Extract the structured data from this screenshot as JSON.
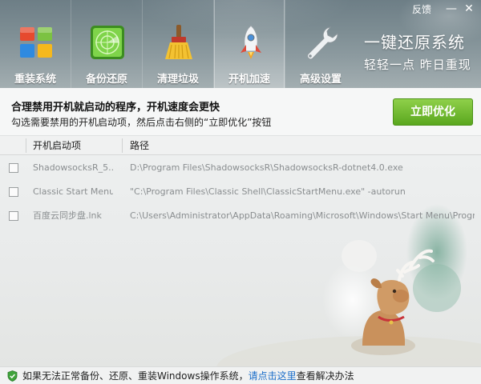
{
  "window": {
    "feedback_label": "反馈",
    "minimize_label": "—",
    "close_label": "✕"
  },
  "tabs": [
    {
      "label": "重装系统",
      "icon": "windows-logo-icon",
      "active": false
    },
    {
      "label": "备份还原",
      "icon": "radar-icon",
      "active": false
    },
    {
      "label": "清理垃圾",
      "icon": "broom-icon",
      "active": false
    },
    {
      "label": "开机加速",
      "icon": "rocket-icon",
      "active": true
    },
    {
      "label": "高级设置",
      "icon": "wrench-icon",
      "active": false
    }
  ],
  "slogan": {
    "main": "一键还原系统",
    "sub": "轻轻一点 昨日重现"
  },
  "info": {
    "title": "合理禁用开机就启动的程序，开机速度会更快",
    "desc": "勾选需要禁用的开机启动项，然后点击右侧的“立即优化”按钮",
    "optimize_button": "立即优化"
  },
  "list": {
    "columns": [
      "开机启动项",
      "路径"
    ],
    "rows": [
      {
        "name": "ShadowsocksR_5...",
        "path": "D:\\Program Files\\ShadowsocksR\\ShadowsocksR-dotnet4.0.exe",
        "checked": false
      },
      {
        "name": "Classic Start Menu",
        "path": "\"C:\\Program Files\\Classic Shell\\ClassicStartMenu.exe\" -autorun",
        "checked": false
      },
      {
        "name": "百度云同步盘.lnk",
        "path": "C:\\Users\\Administrator\\AppData\\Roaming\\Microsoft\\Windows\\Start Menu\\Programs\\St...",
        "checked": false
      }
    ]
  },
  "status": {
    "prefix": "如果无法正常备份、还原、重装Windows操作系统，",
    "link": "请点击这里",
    "suffix": "查看解决办法"
  },
  "colors": {
    "accent_green": "#5aa71e",
    "link_blue": "#1a6dc9",
    "header_gray": "#7d8d93"
  }
}
